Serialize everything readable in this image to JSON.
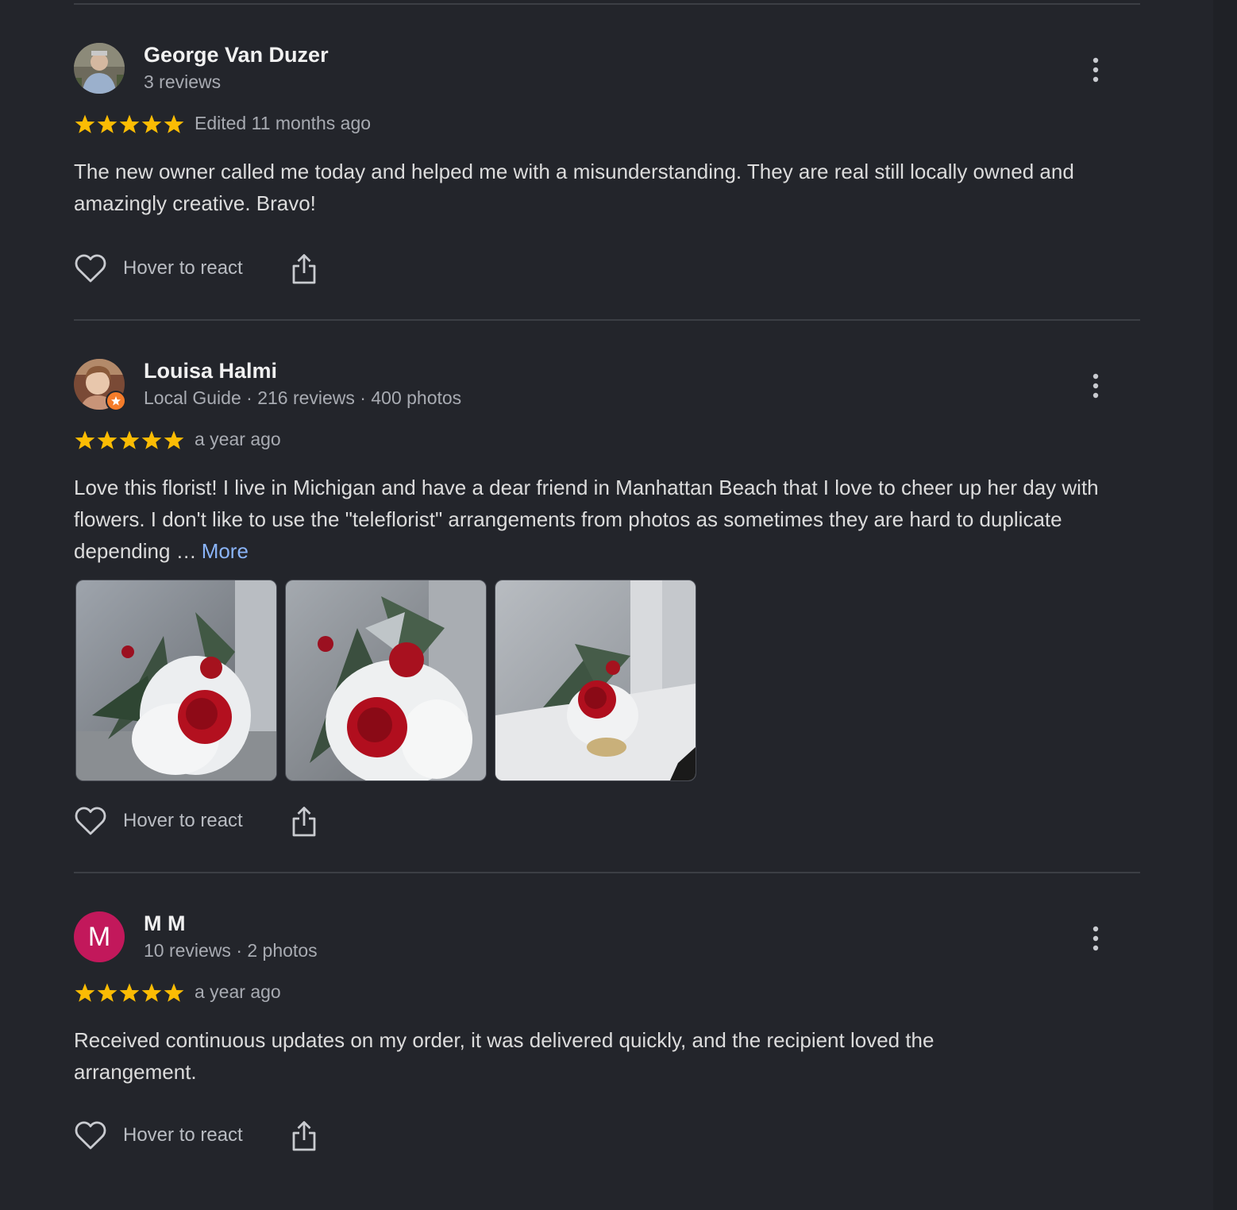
{
  "reviews": [
    {
      "name": "George Van Duzer",
      "meta": "3 reviews",
      "rating": 5,
      "when": "Edited 11 months ago",
      "text": "The new owner called me today and helped me with a misunderstanding. They are real still locally owned and amazingly creative. Bravo!",
      "react_label": "Hover to react"
    },
    {
      "name": "Louisa Halmi",
      "meta": "Local Guide · 216 reviews · 400 photos",
      "rating": 5,
      "when": "a year ago",
      "text": "Love this florist! I live in Michigan and have a dear friend in Manhattan Beach that I love to cheer up her day with flowers. I don't like to use the \"teleflorist\" arrangements from photos as sometimes they are hard to duplicate depending …",
      "more_label": "More",
      "react_label": "Hover to react"
    },
    {
      "name": "M M",
      "avatar_letter": "M",
      "meta": "10 reviews · 2 photos",
      "rating": 5,
      "when": "a year ago",
      "text": "Received continuous updates on my order, it was delivered quickly, and the recipient loved the arrangement.",
      "react_label": "Hover to react"
    }
  ],
  "colors": {
    "background": "#23252b",
    "star": "#fbbc04",
    "link": "#8ab4f8",
    "avatar_mm": "#c2185b",
    "guide_badge": "#f57c2a"
  },
  "icons": [
    "heart-outline-icon",
    "share-icon",
    "more-vert-icon",
    "star-icon",
    "local-guide-badge-icon"
  ]
}
